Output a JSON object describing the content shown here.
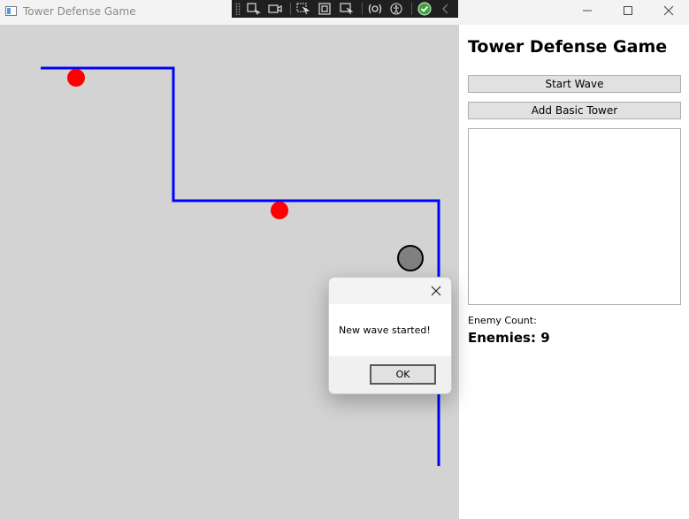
{
  "window": {
    "title": "Tower Defense Game",
    "app_icon": "window-app-icon",
    "controls": [
      "minimize-icon",
      "maximize-icon",
      "close-icon"
    ]
  },
  "debug_toolbar": {
    "tools": [
      "select-element-icon",
      "live-visual-tree-icon",
      "display-layout-adorners-icon",
      "track-focused-element-icon",
      "binding-failures-icon",
      "accessibility-icon",
      "hot-reload-ok-icon",
      "collapse-toolbar-icon"
    ]
  },
  "game": {
    "background": "#d3d3d3",
    "path_color": "#0000ff",
    "enemy_color": "#ff0000",
    "tower_color": "#808080",
    "enemies_visible": 2,
    "towers_visible": 1
  },
  "panel": {
    "title": "Tower Defense Game",
    "start_wave_label": "Start Wave",
    "add_tower_label": "Add Basic Tower",
    "enemy_count_label": "Enemy Count:",
    "enemy_count_value": "Enemies: 9"
  },
  "dialog": {
    "message": "New wave started!",
    "ok_label": "OK"
  }
}
